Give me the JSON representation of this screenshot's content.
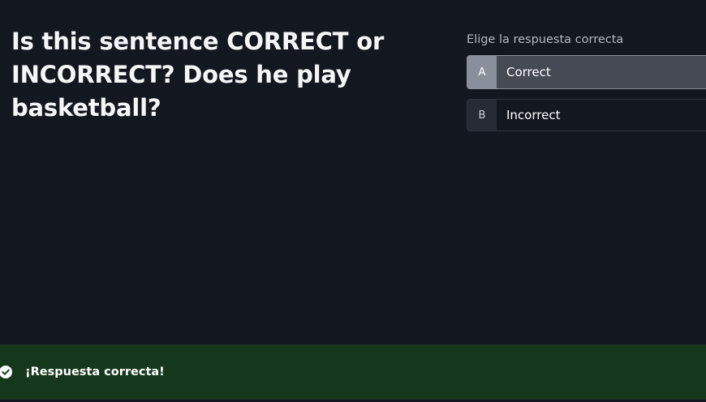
{
  "question": {
    "text": "Is this sentence CORRECT or INCORRECT? Does he play basketball?"
  },
  "answers": {
    "prompt": "Elige la respuesta correcta",
    "options": [
      {
        "letter": "A",
        "label": "Correct",
        "selected": true
      },
      {
        "letter": "B",
        "label": "Incorrect",
        "selected": false
      }
    ]
  },
  "feedback": {
    "message": "¡Respuesta correcta!",
    "icon": "check-circle-icon",
    "status": "correct"
  },
  "colors": {
    "background": "#131720",
    "selected_option": "#454a55",
    "feedback_bar": "#15381c"
  }
}
